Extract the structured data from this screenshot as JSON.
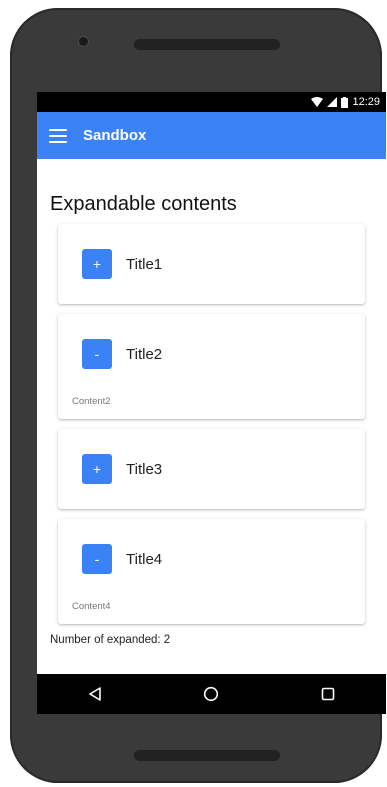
{
  "status_bar": {
    "time": "12:29"
  },
  "app_bar": {
    "title": "Sandbox"
  },
  "page": {
    "heading": "Expandable contents"
  },
  "cards": [
    {
      "toggle": "+",
      "title": "Title1",
      "expanded": false,
      "content": ""
    },
    {
      "toggle": "-",
      "title": "Title2",
      "expanded": true,
      "content": "Content2"
    },
    {
      "toggle": "+",
      "title": "Title3",
      "expanded": false,
      "content": ""
    },
    {
      "toggle": "-",
      "title": "Title4",
      "expanded": true,
      "content": "Content4"
    }
  ],
  "footer": {
    "expanded_count": "Number of expanded: 2"
  },
  "colors": {
    "accent": "#3b82f6",
    "status_bar": "#000000",
    "nav_bar": "#000000"
  },
  "icons": {
    "menu": "menu-icon",
    "back": "back-icon",
    "home": "home-icon",
    "recents": "recents-icon"
  }
}
